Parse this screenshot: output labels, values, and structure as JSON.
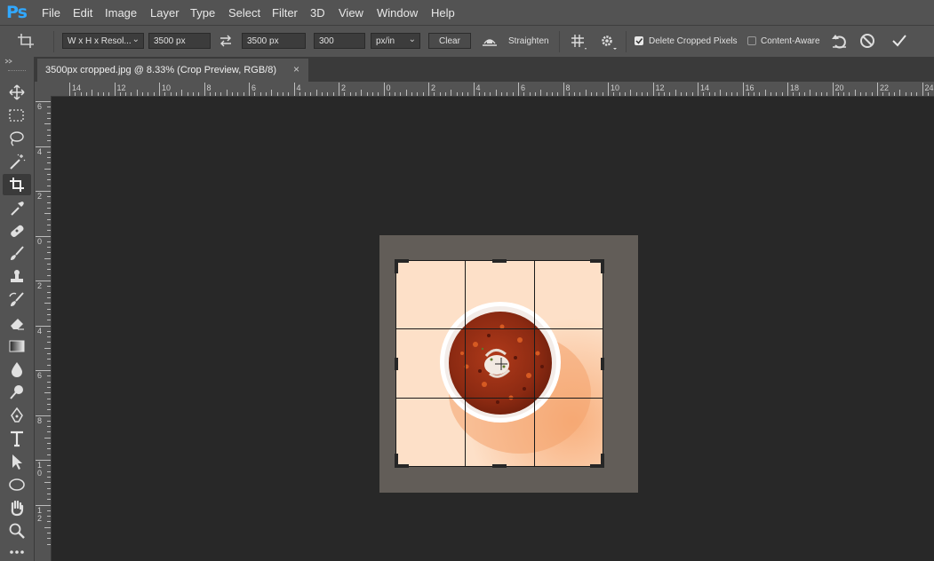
{
  "app": {
    "logo": "Ps"
  },
  "menu": [
    "File",
    "Edit",
    "Image",
    "Layer",
    "Type",
    "Select",
    "Filter",
    "3D",
    "View",
    "Window",
    "Help"
  ],
  "options": {
    "preset": "W x H x Resol...",
    "width": "3500 px",
    "height": "3500 px",
    "resolution": "300",
    "resolution_unit": "px/in",
    "clear": "Clear",
    "straighten": "Straighten",
    "delete_cropped": "Delete Cropped Pixels",
    "delete_cropped_checked": true,
    "content_aware": "Content-Aware",
    "content_aware_checked": false
  },
  "document": {
    "tab_title": "3500px cropped.jpg @ 8.33% (Crop Preview, RGB/8)",
    "close": "×"
  },
  "ruler": {
    "h_labels": [
      "14",
      "12",
      "10",
      "8",
      "6",
      "4",
      "2",
      "0",
      "2",
      "4",
      "6",
      "8",
      "10",
      "12",
      "14",
      "16",
      "18",
      "20",
      "22",
      "24"
    ],
    "v_labels": [
      "6",
      "4",
      "2",
      "0",
      "2",
      "4",
      "6",
      "8",
      "1\n0",
      "1\n2"
    ]
  },
  "tools": [
    "move-tool",
    "marquee-tool",
    "lasso-tool",
    "magic-wand-tool",
    "crop-tool",
    "eyedropper-tool",
    "healing-brush-tool",
    "brush-tool",
    "clone-stamp-tool",
    "history-brush-tool",
    "eraser-tool",
    "gradient-tool",
    "blur-tool",
    "dodge-tool",
    "pen-tool",
    "type-tool",
    "path-selection-tool",
    "ellipse-tool",
    "hand-tool",
    "zoom-tool",
    "more-tools"
  ],
  "active_tool": "crop-tool",
  "colors": {
    "accent": "#31a8ff",
    "canvas": "#282828",
    "panel": "#535353",
    "crop_bg": "#fde0c8",
    "pasteboard": "#625d58"
  }
}
